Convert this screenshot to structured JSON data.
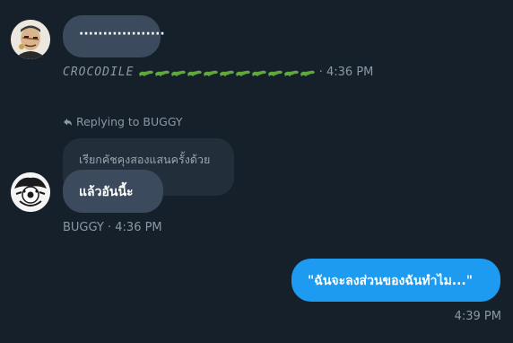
{
  "messages": [
    {
      "text": "··················",
      "sender": "CROCODILE",
      "emoji": [
        "crocodile",
        "crocodile",
        "crocodile",
        "crocodile",
        "crocodile",
        "crocodile",
        "crocodile",
        "crocodile",
        "crocodile",
        "crocodile",
        "crocodile"
      ],
      "separator": " · ",
      "time": "4:36 PM",
      "avatar_icon": "crocodile-avatar-icon"
    },
    {
      "reply_label": "Replying to BUGGY",
      "quoted_text": "เรียกคัชคุงสองแสนครั้งด้วย",
      "text": "แล้วอันนี้ะ",
      "meta": "BUGGY · 4:36 PM",
      "avatar_icon": "buggy-avatar-icon"
    },
    {
      "text": "\"ฉันจะลงส่วนของฉันทำไม...\"",
      "time": "4:39 PM"
    }
  ],
  "colors": {
    "background": "#15202b",
    "incoming_bubble": "#3b4a5c",
    "quote_bubble": "#222f3b",
    "outgoing_bubble": "#1d9bf0",
    "meta_text": "#8b98a5",
    "crocodile_emoji": "#5fa83a"
  }
}
